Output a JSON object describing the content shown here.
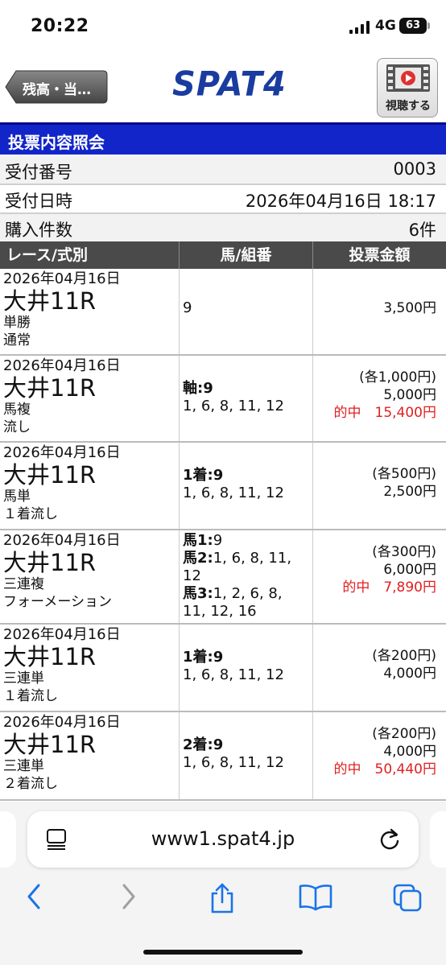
{
  "status": {
    "time": "20:22",
    "network": "4G",
    "battery": "63"
  },
  "header": {
    "back_label": "残高・当…",
    "logo": "SPAT4",
    "watch_label": "視聴する"
  },
  "page_title": "投票内容照会",
  "info": [
    {
      "label": "受付番号",
      "value": "0003"
    },
    {
      "label": "受付日時",
      "value": "2026年04月16日 18:17"
    },
    {
      "label": "購入件数",
      "value": "6件"
    }
  ],
  "table": {
    "headers": {
      "race": "レース/式別",
      "horse": "馬/組番",
      "amount": "投票金額"
    },
    "rows": [
      {
        "date": "2026年04月16日",
        "course": "大井11R",
        "type": "単勝",
        "method": "通常",
        "horse_lines": [
          {
            "label": "",
            "value": "9"
          }
        ],
        "amount_lines": [
          {
            "text": "3,500円",
            "hit": false
          }
        ]
      },
      {
        "date": "2026年04月16日",
        "course": "大井11R",
        "type": "馬複",
        "method": "流し",
        "horse_lines": [
          {
            "label": "軸:9",
            "value": ""
          },
          {
            "label": "",
            "value": "1, 6, 8, 11, 12"
          }
        ],
        "amount_lines": [
          {
            "text": "(各1,000円)",
            "hit": false
          },
          {
            "text": "5,000円",
            "hit": false
          },
          {
            "text": "的中　15,400円",
            "hit": true
          }
        ]
      },
      {
        "date": "2026年04月16日",
        "course": "大井11R",
        "type": "馬単",
        "method": "１着流し",
        "horse_lines": [
          {
            "label": "1着:9",
            "value": ""
          },
          {
            "label": "",
            "value": "1, 6, 8, 11, 12"
          }
        ],
        "amount_lines": [
          {
            "text": "(各500円)",
            "hit": false
          },
          {
            "text": "2,500円",
            "hit": false
          }
        ]
      },
      {
        "date": "2026年04月16日",
        "course": "大井11R",
        "type": "三連複",
        "method": "フォーメーション",
        "horse_lines": [
          {
            "label": "馬1:",
            "value": "9"
          },
          {
            "label": "馬2:",
            "value": "1, 6, 8, 11,"
          },
          {
            "label": "",
            "value": "12"
          },
          {
            "label": "馬3:",
            "value": "1, 2, 6, 8,"
          },
          {
            "label": "",
            "value": "11, 12, 16"
          }
        ],
        "amount_lines": [
          {
            "text": "(各300円)",
            "hit": false
          },
          {
            "text": "6,000円",
            "hit": false
          },
          {
            "text": "的中　7,890円",
            "hit": true
          }
        ]
      },
      {
        "date": "2026年04月16日",
        "course": "大井11R",
        "type": "三連単",
        "method": "１着流し",
        "horse_lines": [
          {
            "label": "1着:9",
            "value": ""
          },
          {
            "label": "",
            "value": "1, 6, 8, 11, 12"
          }
        ],
        "amount_lines": [
          {
            "text": "(各200円)",
            "hit": false
          },
          {
            "text": "4,000円",
            "hit": false
          }
        ]
      },
      {
        "date": "2026年04月16日",
        "course": "大井11R",
        "type": "三連単",
        "method": "２着流し",
        "horse_lines": [
          {
            "label": "2着:9",
            "value": ""
          },
          {
            "label": "",
            "value": "1, 6, 8, 11, 12"
          }
        ],
        "amount_lines": [
          {
            "text": "(各200円)",
            "hit": false
          },
          {
            "text": "4,000円",
            "hit": false
          },
          {
            "text": "的中　50,440円",
            "hit": true
          }
        ]
      }
    ]
  },
  "browser": {
    "url": "www1.spat4.jp"
  },
  "icons": {
    "reader": "reader-mode-icon",
    "reload": "reload-icon",
    "back": "back-arrow-icon",
    "forward": "forward-arrow-icon",
    "share": "share-icon",
    "bookmarks": "bookmarks-icon",
    "tabs": "tabs-icon"
  },
  "colors": {
    "accent": "#1225c8",
    "logo": "#1a3ca0",
    "hit": "#e02020",
    "table_header": "#4a4a4a",
    "ios_blue": "#1a73e8"
  }
}
